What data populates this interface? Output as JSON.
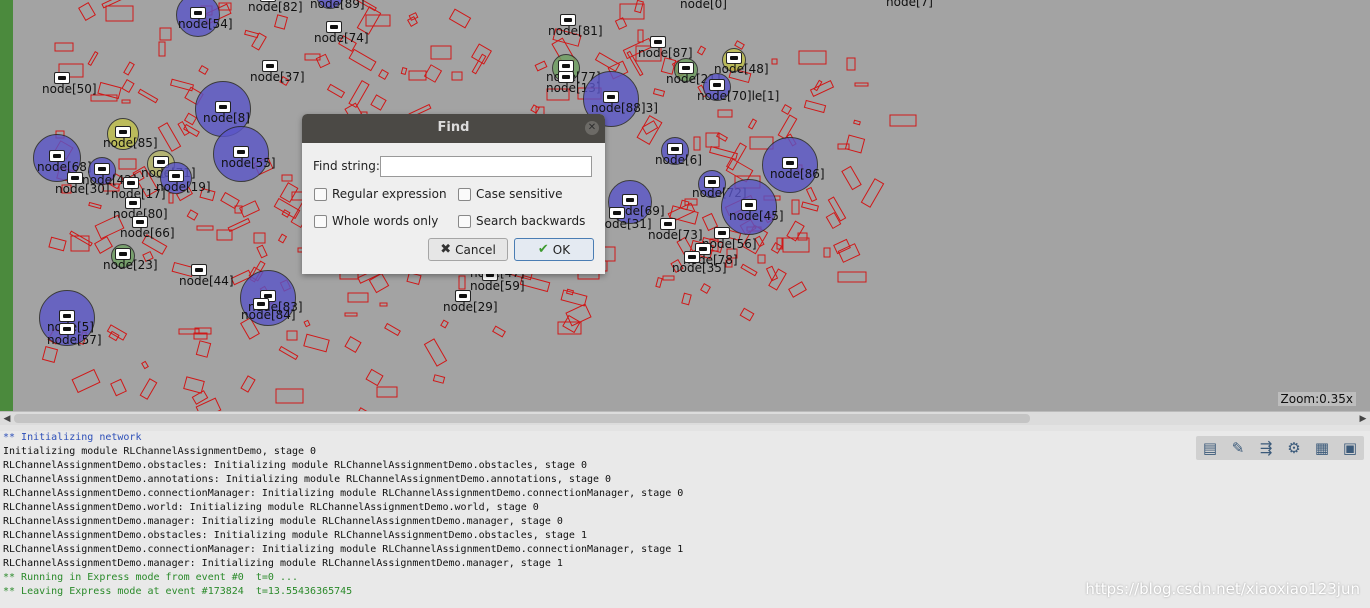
{
  "map": {
    "zoom_label": "Zoom:0.35x",
    "nodes": [
      {
        "id": "node-54",
        "label": "node[54]"
      },
      {
        "id": "node-82",
        "label": "node[82]"
      },
      {
        "id": "node-89",
        "label": "node[89]"
      },
      {
        "id": "node-74",
        "label": "node[74]"
      },
      {
        "id": "node-0",
        "label": "node[0]"
      },
      {
        "id": "node-7",
        "label": "node[7]"
      },
      {
        "id": "node-81",
        "label": "node[81]"
      },
      {
        "id": "node-87",
        "label": "node[87]"
      },
      {
        "id": "node-48",
        "label": "node[48]"
      },
      {
        "id": "node-50",
        "label": "node[50]"
      },
      {
        "id": "node-37",
        "label": "node[37]"
      },
      {
        "id": "node-77",
        "label": "node[77]"
      },
      {
        "id": "node-13",
        "label": "node[13]"
      },
      {
        "id": "node-21",
        "label": "node[21]"
      },
      {
        "id": "node-70",
        "label": "node[70]le[1]"
      },
      {
        "id": "node-88",
        "label": "node[88]3]"
      },
      {
        "id": "node-8",
        "label": "node[8]"
      },
      {
        "id": "node-85",
        "label": "node[85]"
      },
      {
        "id": "node-68",
        "label": "node[68]"
      },
      {
        "id": "node-71",
        "label": "node[71]"
      },
      {
        "id": "node-55",
        "label": "node[55]"
      },
      {
        "id": "node-42",
        "label": "node[42]"
      },
      {
        "id": "node-30",
        "label": "node[30]"
      },
      {
        "id": "node-19",
        "label": "node[19]"
      },
      {
        "id": "node-17",
        "label": "node[17]"
      },
      {
        "id": "node-6",
        "label": "node[6]"
      },
      {
        "id": "node-86",
        "label": "node[86]"
      },
      {
        "id": "node-72",
        "label": "node[72]"
      },
      {
        "id": "node-45",
        "label": "node[45]"
      },
      {
        "id": "node-69",
        "label": "node[69]"
      },
      {
        "id": "node-80",
        "label": "node[80]"
      },
      {
        "id": "node-31",
        "label": "node[31]"
      },
      {
        "id": "node-66",
        "label": "node[66]"
      },
      {
        "id": "node-73",
        "label": "node[73]"
      },
      {
        "id": "node-56",
        "label": "node[56]"
      },
      {
        "id": "node-78",
        "label": "node[78]"
      },
      {
        "id": "node-35",
        "label": "node[35]"
      },
      {
        "id": "node-23",
        "label": "node[23]"
      },
      {
        "id": "node-44",
        "label": "node[44]"
      },
      {
        "id": "node-47",
        "label": "node[47]"
      },
      {
        "id": "node-59",
        "label": "node[59]"
      },
      {
        "id": "node-83",
        "label": "node[83]"
      },
      {
        "id": "node-84",
        "label": "node[84]"
      },
      {
        "id": "node-29",
        "label": "node[29]"
      },
      {
        "id": "node-5",
        "label": "node[5]"
      },
      {
        "id": "node-57",
        "label": "node[57]"
      }
    ]
  },
  "find_dialog": {
    "title": "Find",
    "find_string_label": "Find string:",
    "find_string_value": "",
    "options": [
      {
        "label": "Regular expression",
        "checked": false
      },
      {
        "label": "Case sensitive",
        "checked": false
      },
      {
        "label": "Whole words only",
        "checked": false
      },
      {
        "label": "Search backwards",
        "checked": false
      }
    ],
    "cancel_label": "Cancel",
    "ok_label": "OK"
  },
  "log": {
    "lines": [
      "** Initializing network",
      "Initializing module RLChannelAssignmentDemo, stage 0",
      "RLChannelAssignmentDemo.obstacles: Initializing module RLChannelAssignmentDemo.obstacles, stage 0",
      "RLChannelAssignmentDemo.annotations: Initializing module RLChannelAssignmentDemo.annotations, stage 0",
      "RLChannelAssignmentDemo.connectionManager: Initializing module RLChannelAssignmentDemo.connectionManager, stage 0",
      "RLChannelAssignmentDemo.world: Initializing module RLChannelAssignmentDemo.world, stage 0",
      "RLChannelAssignmentDemo.manager: Initializing module RLChannelAssignmentDemo.manager, stage 0",
      "RLChannelAssignmentDemo.obstacles: Initializing module RLChannelAssignmentDemo.obstacles, stage 1",
      "RLChannelAssignmentDemo.connectionManager: Initializing module RLChannelAssignmentDemo.connectionManager, stage 1",
      "RLChannelAssignmentDemo.manager: Initializing module RLChannelAssignmentDemo.manager, stage 1",
      "** Running in Express mode from event #0  t=0 ...",
      "** Leaving Express mode at event #173824  t=13.55436365745"
    ]
  },
  "toolbar": {
    "icons": [
      "document-icon",
      "pin-icon",
      "step-icon",
      "gear-icon",
      "layout-icon",
      "monitor-icon"
    ]
  },
  "watermark": "https://blog.csdn.net/xiaoxiao123jun"
}
